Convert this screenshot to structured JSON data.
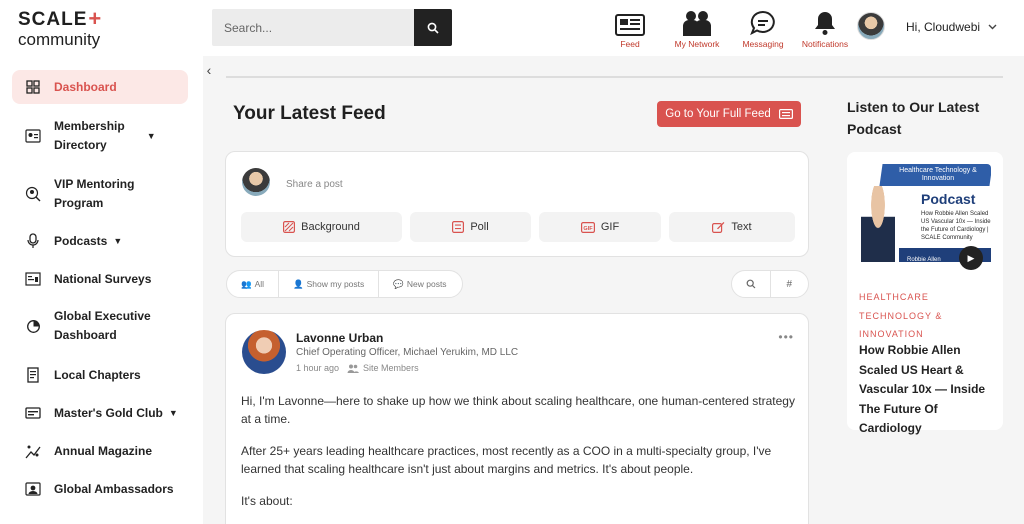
{
  "brand": {
    "logo_top": "SCALE",
    "logo_plus": "+",
    "logo_bottom": "community"
  },
  "search": {
    "placeholder": "Search..."
  },
  "nav": {
    "feed": "Feed",
    "network": "My Network",
    "messaging": "Messaging",
    "notifications": "Notifications"
  },
  "user": {
    "greeting": "Hi, Cloudwebi"
  },
  "sidebar": {
    "items": [
      {
        "label": "Dashboard",
        "icon": "dashboard-icon"
      },
      {
        "label": "Membership\nDirectory",
        "icon": "directory-icon"
      },
      {
        "label": "VIP Mentoring\nProgram",
        "icon": "mentoring-icon"
      },
      {
        "label": "Podcasts",
        "icon": "microphone-icon"
      },
      {
        "label": "National Surveys",
        "icon": "survey-icon"
      },
      {
        "label": "Global Executive\nDashboard",
        "icon": "pie-chart-icon"
      },
      {
        "label": "Local Chapters",
        "icon": "chapters-icon"
      },
      {
        "label": "Master's Gold Club",
        "icon": "gold-club-icon"
      },
      {
        "label": "Annual Magazine",
        "icon": "magazine-icon"
      },
      {
        "label": "Global Ambassadors",
        "icon": "ambassadors-icon"
      }
    ]
  },
  "main": {
    "title": "Your Latest Feed",
    "full_feed_button": "Go to Your Full Feed",
    "share_placeholder": "Share a post",
    "post_types": [
      "Background",
      "Poll",
      "GIF",
      "Text"
    ],
    "filters": [
      "All",
      "Show my posts",
      "New posts"
    ]
  },
  "post": {
    "author": "Lavonne Urban",
    "title": "Chief Operating Officer, Michael Yerukim, MD LLC",
    "time": "1 hour ago",
    "audience": "Site Members",
    "paragraphs": [
      "Hi, I'm Lavonne—here to shake up how we think about scaling healthcare, one human-centered strategy at a time.",
      "After 25+ years leading healthcare practices, most recently as a COO in a multi-specialty group, I've learned that scaling healthcare isn't just about margins and metrics. It's about people.",
      "It's about:"
    ]
  },
  "right": {
    "title": "Listen to Our Latest Podcast",
    "thumb_band": "Healthcare Technology & Innovation",
    "thumb_title": "Podcast",
    "thumb_sub": "How Robbie Allen Scaled US Vascular 10x — Inside the Future of Cardiology | SCALE Community",
    "thumb_guest": "Robbie Allen",
    "category": "HEALTHCARE TECHNOLOGY & INNOVATION",
    "headline": "How Robbie Allen Scaled US Heart & Vascular 10x — Inside The Future Of Cardiology"
  },
  "colors": {
    "accent": "#d9534f",
    "active_bg": "#fce8e6"
  }
}
